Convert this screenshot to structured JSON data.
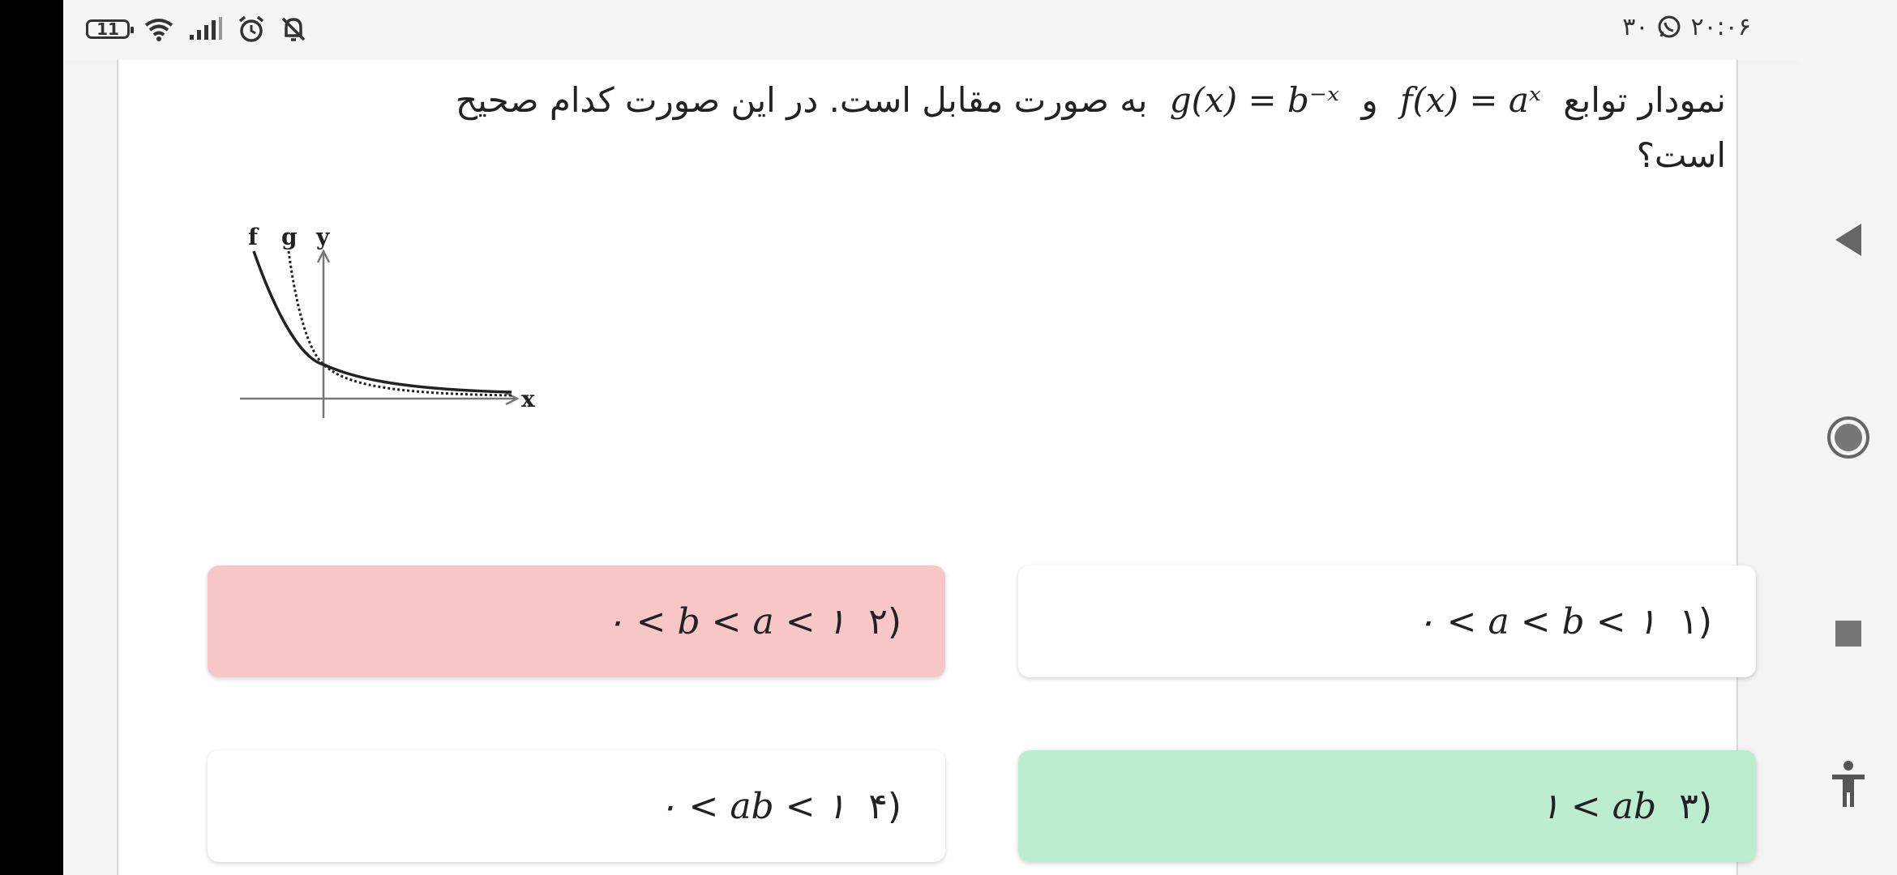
{
  "status_bar": {
    "battery": "11",
    "clock": "۲۰:۰۶",
    "extra_text": "۳۰",
    "icons": [
      "battery-icon",
      "wifi-icon",
      "signal-icon",
      "alarm-icon",
      "bell-off-icon",
      "whatsapp-icon"
    ]
  },
  "question": {
    "prefix": "نمودار توابع",
    "f_expr": "f(x) = aˣ",
    "and": "و",
    "g_expr": "g(x) = b⁻ˣ",
    "suffix": "به صورت مقابل است. در این صورت کدام صحیح است؟"
  },
  "graph": {
    "labels": {
      "f": "f",
      "g": "g",
      "y": "y",
      "x": "x"
    }
  },
  "options": [
    {
      "number": "(۱",
      "expr": "۰ < a < b < ۱",
      "state": "normal"
    },
    {
      "number": "(۲",
      "expr": "۰ < b < a < ۱",
      "state": "wrong"
    },
    {
      "number": "(۳",
      "expr": "۱ < ab",
      "state": "correct"
    },
    {
      "number": "(۴",
      "expr": "۰ < ab < ۱",
      "state": "normal"
    }
  ],
  "nav_bar": {
    "icons": [
      "back-icon",
      "home-icon",
      "recents-icon",
      "accessibility-icon"
    ]
  },
  "colors": {
    "wrong_bg": "#f7c6c6",
    "correct_bg": "#bcedd0",
    "card_bg": "#ffffff"
  }
}
